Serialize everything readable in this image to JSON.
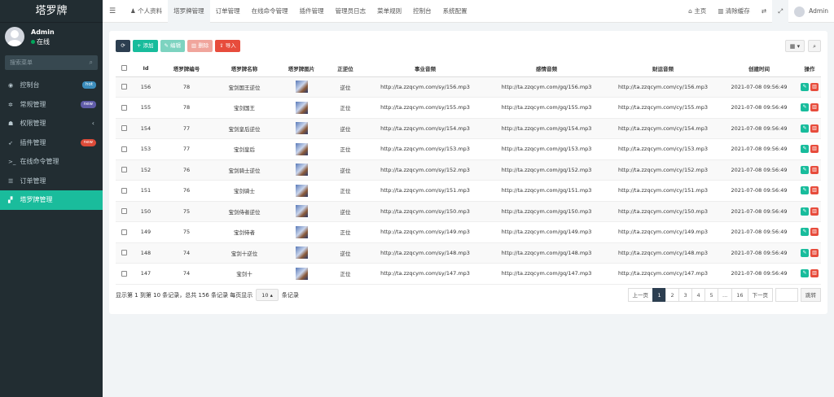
{
  "sidebar": {
    "logo": "塔罗牌",
    "user": {
      "name": "Admin",
      "status": "在线"
    },
    "search_placeholder": "搜索菜单",
    "items": [
      {
        "label": "控制台",
        "icon": "dashboard-icon",
        "glyph": "◉",
        "badge": "hot"
      },
      {
        "label": "常规管理",
        "icon": "cogs-icon",
        "glyph": "✲",
        "badge": "new"
      },
      {
        "label": "权限管理",
        "icon": "group-icon",
        "glyph": "☗",
        "chevron": "‹"
      },
      {
        "label": "插件管理",
        "icon": "rocket-icon",
        "glyph": "➶",
        "badge": "new"
      },
      {
        "label": "在线命令管理",
        "icon": "terminal-icon",
        "glyph": ">_"
      },
      {
        "label": "订单管理",
        "icon": "list-icon",
        "glyph": "☰"
      },
      {
        "label": "塔罗牌管理",
        "icon": "bar-chart-icon",
        "glyph": "▞"
      }
    ]
  },
  "topbar": {
    "tabs": [
      "个人资料",
      "塔罗牌管理",
      "订单管理",
      "在线命令管理",
      "插件管理",
      "管理员日志",
      "菜单规则",
      "控制台",
      "系统配置"
    ],
    "home": "主页",
    "clear_cache": "清除缓存",
    "user": "Admin"
  },
  "toolbar": {
    "add": "添加",
    "edit": "编辑",
    "delete": "删除",
    "import": "导入"
  },
  "table": {
    "headers": [
      "Id",
      "塔罗牌编号",
      "塔罗牌名称",
      "塔罗牌图片",
      "正逆位",
      "事业音频",
      "感情音频",
      "财运音频",
      "创建时间",
      "操作"
    ],
    "rows": [
      {
        "id": "156",
        "num": "78",
        "name": "宝剑国王逆位",
        "pos": "逆位",
        "career": "http://ta.zzqcym.com/sy/156.mp3",
        "love": "http://ta.zzqcym.com/gq/156.mp3",
        "wealth": "http://ta.zzqcym.com/cy/156.mp3",
        "time": "2021-07-08 09:56:49"
      },
      {
        "id": "155",
        "num": "78",
        "name": "宝剑国王",
        "pos": "正位",
        "career": "http://ta.zzqcym.com/sy/155.mp3",
        "love": "http://ta.zzqcym.com/gq/155.mp3",
        "wealth": "http://ta.zzqcym.com/cy/155.mp3",
        "time": "2021-07-08 09:56:49"
      },
      {
        "id": "154",
        "num": "77",
        "name": "宝剑皇后逆位",
        "pos": "逆位",
        "career": "http://ta.zzqcym.com/sy/154.mp3",
        "love": "http://ta.zzqcym.com/gq/154.mp3",
        "wealth": "http://ta.zzqcym.com/cy/154.mp3",
        "time": "2021-07-08 09:56:49"
      },
      {
        "id": "153",
        "num": "77",
        "name": "宝剑皇后",
        "pos": "正位",
        "career": "http://ta.zzqcym.com/sy/153.mp3",
        "love": "http://ta.zzqcym.com/gq/153.mp3",
        "wealth": "http://ta.zzqcym.com/cy/153.mp3",
        "time": "2021-07-08 09:56:49"
      },
      {
        "id": "152",
        "num": "76",
        "name": "宝剑骑士逆位",
        "pos": "逆位",
        "career": "http://ta.zzqcym.com/sy/152.mp3",
        "love": "http://ta.zzqcym.com/gq/152.mp3",
        "wealth": "http://ta.zzqcym.com/cy/152.mp3",
        "time": "2021-07-08 09:56:49"
      },
      {
        "id": "151",
        "num": "76",
        "name": "宝剑骑士",
        "pos": "正位",
        "career": "http://ta.zzqcym.com/sy/151.mp3",
        "love": "http://ta.zzqcym.com/gq/151.mp3",
        "wealth": "http://ta.zzqcym.com/cy/151.mp3",
        "time": "2021-07-08 09:56:49"
      },
      {
        "id": "150",
        "num": "75",
        "name": "宝剑侍者逆位",
        "pos": "逆位",
        "career": "http://ta.zzqcym.com/sy/150.mp3",
        "love": "http://ta.zzqcym.com/gq/150.mp3",
        "wealth": "http://ta.zzqcym.com/cy/150.mp3",
        "time": "2021-07-08 09:56:49"
      },
      {
        "id": "149",
        "num": "75",
        "name": "宝剑侍者",
        "pos": "正位",
        "career": "http://ta.zzqcym.com/sy/149.mp3",
        "love": "http://ta.zzqcym.com/gq/149.mp3",
        "wealth": "http://ta.zzqcym.com/cy/149.mp3",
        "time": "2021-07-08 09:56:49"
      },
      {
        "id": "148",
        "num": "74",
        "name": "宝剑十逆位",
        "pos": "逆位",
        "career": "http://ta.zzqcym.com/sy/148.mp3",
        "love": "http://ta.zzqcym.com/gq/148.mp3",
        "wealth": "http://ta.zzqcym.com/cy/148.mp3",
        "time": "2021-07-08 09:56:49"
      },
      {
        "id": "147",
        "num": "74",
        "name": "宝剑十",
        "pos": "正位",
        "career": "http://ta.zzqcym.com/sy/147.mp3",
        "love": "http://ta.zzqcym.com/gq/147.mp3",
        "wealth": "http://ta.zzqcym.com/cy/147.mp3",
        "time": "2021-07-08 09:56:49"
      }
    ]
  },
  "footer": {
    "info_prefix": "显示第 1 到第 10 条记录，总共 156 条记录 每页显示",
    "page_size": "10",
    "info_suffix": "条记录",
    "prev": "上一页",
    "pages": [
      "1",
      "2",
      "3",
      "4",
      "5",
      "...",
      "16"
    ],
    "next": "下一页",
    "jump": "跳转"
  },
  "colors": {
    "sidebar_bg": "#222d32",
    "accent": "#1abc9c",
    "danger": "#e74c3c",
    "dark": "#2c3e50"
  }
}
